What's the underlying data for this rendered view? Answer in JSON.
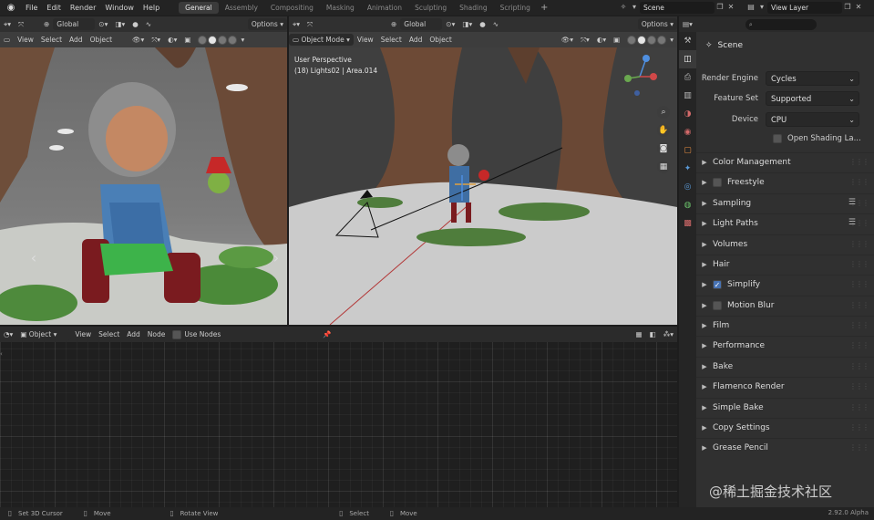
{
  "topbar": {
    "menus": [
      "File",
      "Edit",
      "Render",
      "Window",
      "Help"
    ],
    "workspaces": [
      "General",
      "Assembly",
      "Compositing",
      "Masking",
      "Animation",
      "Sculpting",
      "Shading",
      "Scripting"
    ],
    "active_workspace": "General",
    "scene_name": "Scene",
    "view_layer": "View Layer"
  },
  "left_viewport": {
    "orientation": "Global",
    "options_label": "Options",
    "menus": [
      "View",
      "Select",
      "Add",
      "Object"
    ]
  },
  "right_viewport": {
    "orientation": "Global",
    "options_label": "Options",
    "mode": "Object Mode",
    "menus": [
      "View",
      "Select",
      "Add",
      "Object"
    ],
    "perspective": "User Perspective",
    "active_info": "(18) Lights02 | Area.014"
  },
  "node_editor": {
    "type": "Object",
    "menus": [
      "View",
      "Select",
      "Add",
      "Node"
    ],
    "use_nodes_label": "Use Nodes"
  },
  "properties": {
    "search_placeholder": "",
    "title": "Scene",
    "render_engine": {
      "label": "Render Engine",
      "value": "Cycles"
    },
    "feature_set": {
      "label": "Feature Set",
      "value": "Supported"
    },
    "device": {
      "label": "Device",
      "value": "CPU"
    },
    "open_shading": "Open Shading La...",
    "sections": [
      "Color Management",
      "Freestyle",
      "Sampling",
      "Light Paths",
      "Volumes",
      "Hair",
      "Simplify",
      "Motion Blur",
      "Film",
      "Performance",
      "Bake",
      "Flamenco Render",
      "Simple Bake",
      "Copy Settings",
      "Grease Pencil"
    ]
  },
  "statusbar": {
    "items": [
      "Set 3D Cursor",
      "Move",
      "Rotate View",
      "Select",
      "Move"
    ],
    "version": "2.92.0 Alpha"
  },
  "watermark": "@稀土掘金技术社区"
}
